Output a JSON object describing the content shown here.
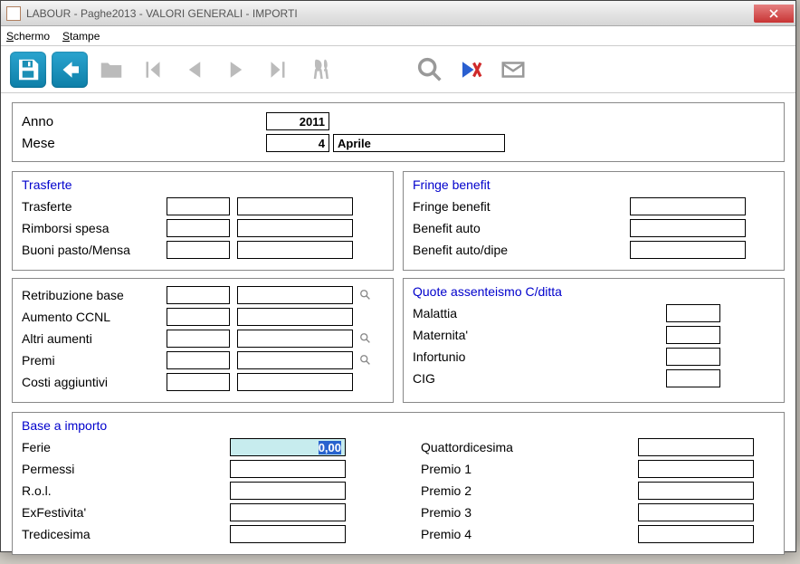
{
  "window": {
    "title": "LABOUR - Paghe2013 - VALORI GENERALI - IMPORTI"
  },
  "menu": {
    "schermo": "Schermo",
    "stampe": "Stampe"
  },
  "header": {
    "anno_label": "Anno",
    "anno_value": "2011",
    "mese_label": "Mese",
    "mese_value": "4",
    "mese_name": "Aprile"
  },
  "trasferte": {
    "title": "Trasferte",
    "rows": [
      {
        "label": "Trasferte",
        "v1": "",
        "v2": ""
      },
      {
        "label": "Rimborsi spesa",
        "v1": "",
        "v2": ""
      },
      {
        "label": "Buoni pasto/Mensa",
        "v1": "",
        "v2": ""
      }
    ]
  },
  "fringe": {
    "title": "Fringe benefit",
    "rows": [
      {
        "label": "Fringe benefit",
        "v": ""
      },
      {
        "label": "Benefit auto",
        "v": ""
      },
      {
        "label": "Benefit auto/dipe",
        "v": ""
      }
    ]
  },
  "retrib": {
    "rows": [
      {
        "label": "Retribuzione base",
        "v1": "",
        "v2": "",
        "lookup": true
      },
      {
        "label": "Aumento CCNL",
        "v1": "",
        "v2": ""
      },
      {
        "label": "Altri aumenti",
        "v1": "",
        "v2": "",
        "lookup": true
      },
      {
        "label": "Premi",
        "v1": "",
        "v2": "",
        "lookup": true
      },
      {
        "label": "Costi aggiuntivi",
        "v1": "",
        "v2": ""
      }
    ]
  },
  "quote": {
    "title": "Quote assenteismo C/ditta",
    "rows": [
      {
        "label": "Malattia",
        "v": ""
      },
      {
        "label": "Maternita'",
        "v": ""
      },
      {
        "label": "Infortunio",
        "v": ""
      },
      {
        "label": "CIG",
        "v": ""
      }
    ]
  },
  "base": {
    "title": "Base a importo",
    "left": [
      {
        "label": "Ferie",
        "v": "0,00",
        "selected": true
      },
      {
        "label": "Permessi",
        "v": ""
      },
      {
        "label": "R.o.l.",
        "v": ""
      },
      {
        "label": "ExFestivita'",
        "v": ""
      },
      {
        "label": "Tredicesima",
        "v": ""
      }
    ],
    "right": [
      {
        "label": "Quattordicesima",
        "v": ""
      },
      {
        "label": "Premio 1",
        "v": ""
      },
      {
        "label": "Premio 2",
        "v": ""
      },
      {
        "label": "Premio 3",
        "v": ""
      },
      {
        "label": "Premio 4",
        "v": ""
      }
    ]
  }
}
